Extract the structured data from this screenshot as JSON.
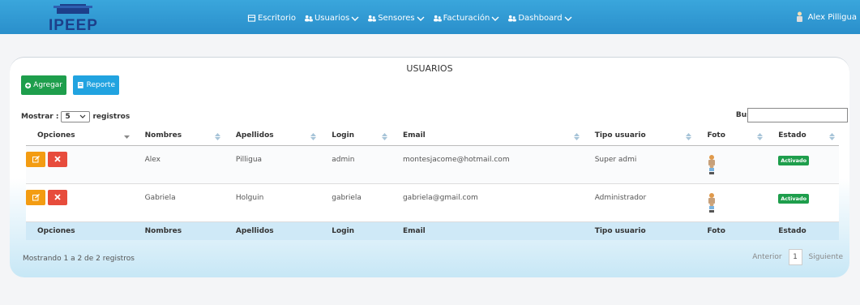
{
  "brand": {
    "logo_text": "IPEEP"
  },
  "colors": {
    "topbar": "#2f9bd6",
    "add": "#1e9e4c",
    "report": "#21a3e0",
    "edit": "#f39c12",
    "delete": "#e74c3c",
    "badge": "#1e9e4c"
  },
  "nav": {
    "escritorio": "Escritorio",
    "usuarios": "Usuarios",
    "sensores": "Sensores",
    "facturacion": "Facturación",
    "dashboard": "Dashboard"
  },
  "user": {
    "name": "Alex Pilligua"
  },
  "page": {
    "title": "USUARIOS"
  },
  "toolbar": {
    "add_label": "Agregar",
    "report_label": "Reporte"
  },
  "length": {
    "prefix": "Mostrar :",
    "value": "5",
    "suffix": "registros"
  },
  "search": {
    "label": "Buscar:",
    "value": ""
  },
  "table": {
    "headers": [
      "Opciones",
      "Nombres",
      "Apellidos",
      "Login",
      "Email",
      "Tipo usuario",
      "Foto",
      "Estado"
    ],
    "rows": [
      {
        "nombres": "Alex",
        "apellidos": "Pilligua",
        "login": "admin",
        "email": "montesjacome@hotmail.com",
        "tipo": "Super admi",
        "estado": "Activado"
      },
      {
        "nombres": "Gabriela",
        "apellidos": "Holguin",
        "login": "gabriela",
        "email": "gabriela@gmail.com",
        "tipo": "Administrador",
        "estado": "Activado"
      }
    ]
  },
  "footer": {
    "info": "Mostrando 1 a 2 de 2 registros",
    "prev": "Anterior",
    "page": "1",
    "next": "Siguiente"
  }
}
